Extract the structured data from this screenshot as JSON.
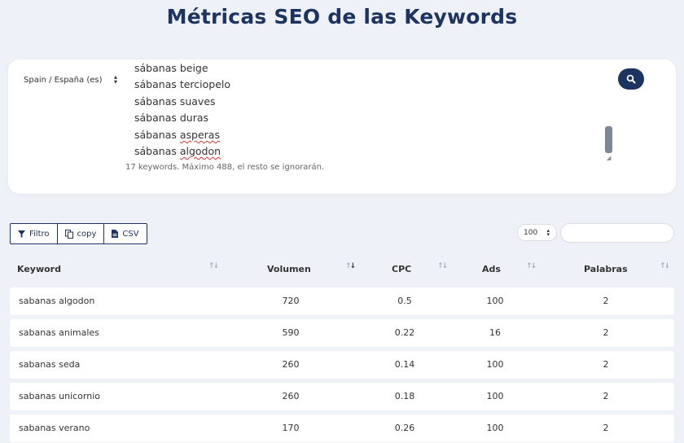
{
  "page": {
    "title": "Métricas SEO de las Keywords"
  },
  "form": {
    "country_select": "Spain / España (es)",
    "keywords": [
      {
        "text": "sábanas beige"
      },
      {
        "text": "sábanas terciopelo"
      },
      {
        "text": "sábanas suaves"
      },
      {
        "text": "sábanas duras"
      },
      {
        "text": "sábanas asperas"
      },
      {
        "text": "sábanas algodon"
      }
    ],
    "hint": "17 keywords. Máximo 488, el resto se ignorarán."
  },
  "toolbar": {
    "filter_label": "Filtro",
    "copy_label": "copy",
    "csv_label": "CSV",
    "page_size": "100",
    "search_placeholder": ""
  },
  "table": {
    "headers": {
      "keyword": "Keyword",
      "volume": "Volumen",
      "cpc": "CPC",
      "ads": "Ads",
      "words": "Palabras"
    },
    "rows": [
      {
        "keyword": "sabanas algodon",
        "volume": "720",
        "cpc": "0.5",
        "ads": "100",
        "words": "2"
      },
      {
        "keyword": "sabanas animales",
        "volume": "590",
        "cpc": "0.22",
        "ads": "16",
        "words": "2"
      },
      {
        "keyword": "sabanas seda",
        "volume": "260",
        "cpc": "0.14",
        "ads": "100",
        "words": "2"
      },
      {
        "keyword": "sabanas unicornio",
        "volume": "260",
        "cpc": "0.18",
        "ads": "100",
        "words": "2"
      },
      {
        "keyword": "sabanas verano",
        "volume": "170",
        "cpc": "0.26",
        "ads": "100",
        "words": "2"
      }
    ]
  },
  "colors": {
    "brand": "#1d3461",
    "background": "#eef2f8"
  }
}
